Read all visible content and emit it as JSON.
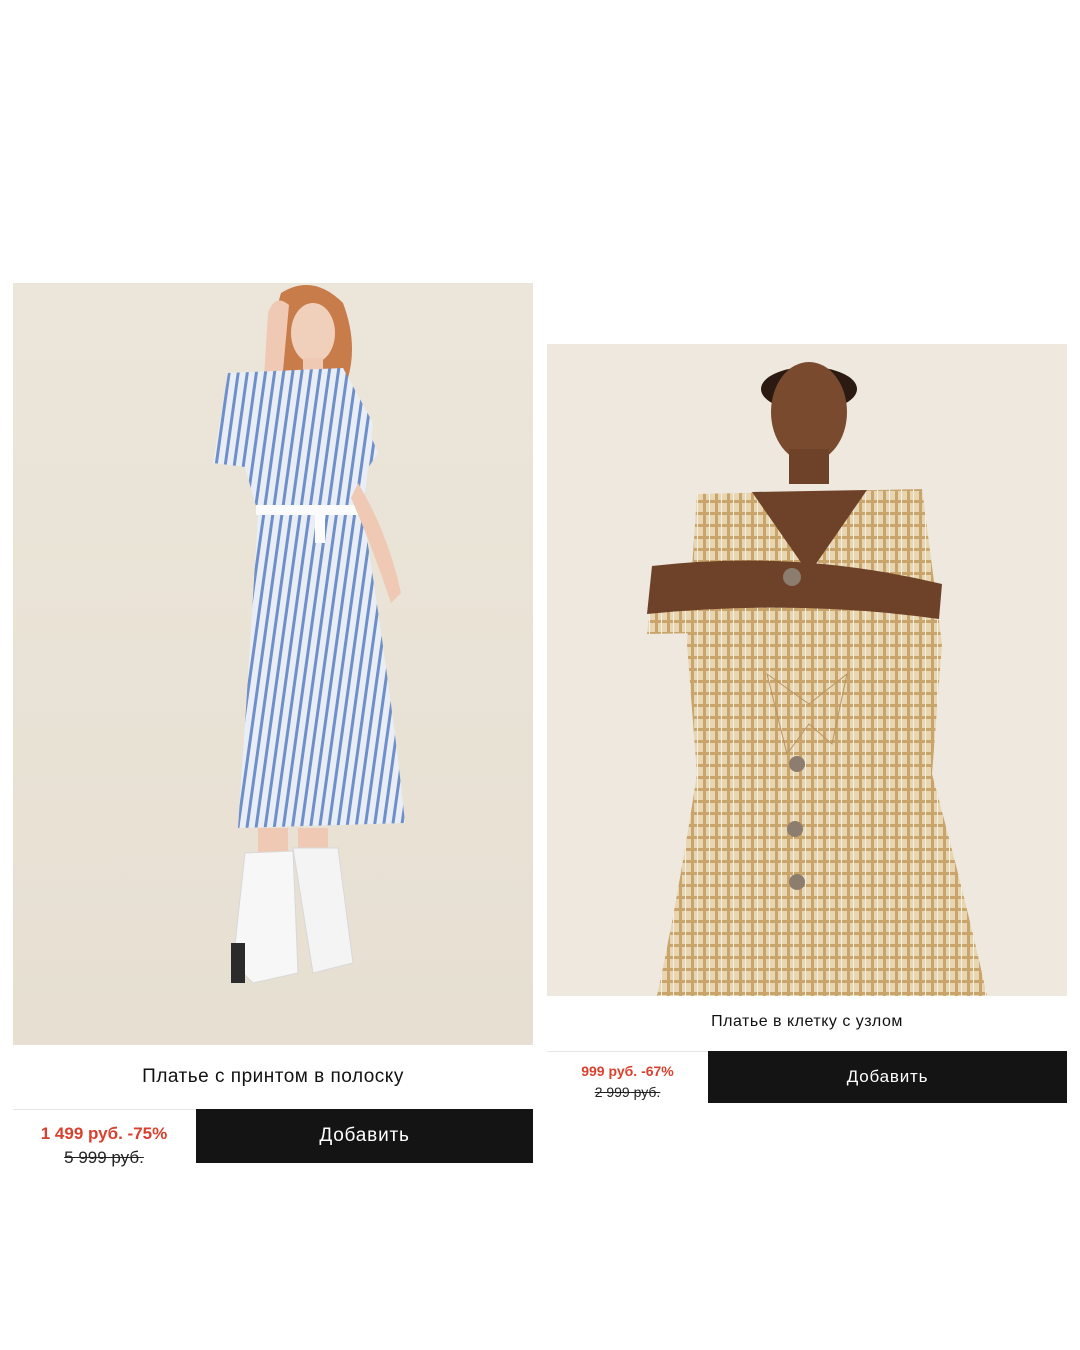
{
  "products": [
    {
      "title": "Платье с принтом в полоску",
      "sale_price": "1 499 руб. -75%",
      "old_price": "5 999 руб.",
      "button_label": "Добавить",
      "dress_color": "#b9c9e4",
      "backdrop_color": "#eee8dd"
    },
    {
      "title": "Платье в клетку с узлом",
      "sale_price": "999 руб. -67%",
      "old_price": "2 999 руб.",
      "button_label": "Добавить",
      "dress_color": "#dcc499",
      "backdrop_color": "#efe9df"
    }
  ],
  "colors": {
    "sale": "#d9412f",
    "button_bg": "#141414",
    "button_text": "#ffffff"
  }
}
